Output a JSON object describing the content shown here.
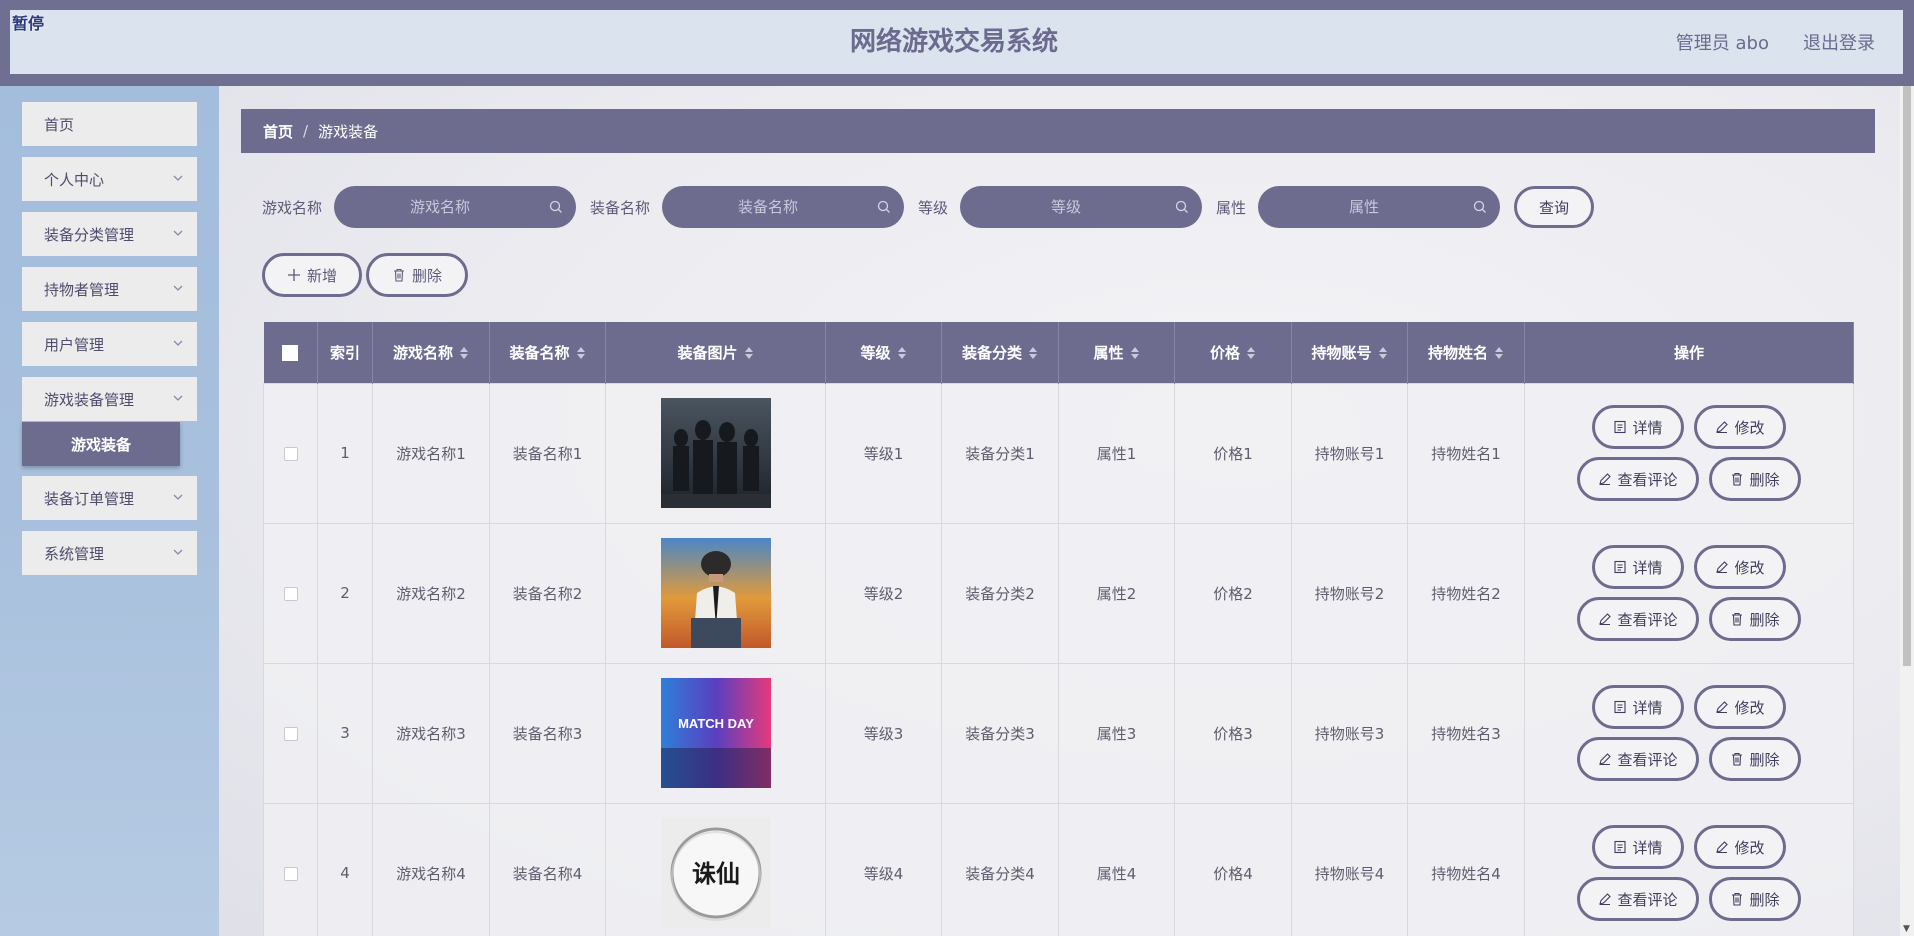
{
  "header": {
    "pause_tag": "暂停",
    "title": "网络游戏交易系统",
    "user": "管理员 abo",
    "logout": "退出登录"
  },
  "sidebar": {
    "items": [
      {
        "label": "首页",
        "icon": "none"
      },
      {
        "label": "个人中心",
        "icon": "chevron-down-icon"
      },
      {
        "label": "装备分类管理",
        "icon": "chevron-down-icon"
      },
      {
        "label": "持物者管理",
        "icon": "chevron-down-icon"
      },
      {
        "label": "用户管理",
        "icon": "chevron-down-icon"
      },
      {
        "label": "游戏装备管理",
        "icon": "chevron-down-icon"
      },
      {
        "label": "装备订单管理",
        "icon": "chevron-down-icon"
      },
      {
        "label": "系统管理",
        "icon": "chevron-down-icon"
      }
    ],
    "active_sub": "游戏装备"
  },
  "breadcrumb": {
    "home": "首页",
    "separator": "/",
    "current": "游戏装备"
  },
  "search": {
    "fields": [
      {
        "label": "游戏名称",
        "placeholder": "游戏名称"
      },
      {
        "label": "装备名称",
        "placeholder": "装备名称"
      },
      {
        "label": "等级",
        "placeholder": "等级"
      },
      {
        "label": "属性",
        "placeholder": "属性"
      }
    ],
    "query_label": "查询"
  },
  "actions": {
    "add_label": "新增",
    "delete_label": "删除"
  },
  "table": {
    "headers": [
      "索引",
      "游戏名称",
      "装备名称",
      "装备图片",
      "等级",
      "装备分类",
      "属性",
      "价格",
      "持物账号",
      "持物姓名",
      "操作"
    ],
    "rows": [
      {
        "index": "1",
        "game": "游戏名称1",
        "equip": "装备名称1",
        "level": "等级1",
        "category": "装备分类1",
        "attr": "属性1",
        "price": "价格1",
        "account": "持物账号1",
        "owner": "持物姓名1"
      },
      {
        "index": "2",
        "game": "游戏名称2",
        "equip": "装备名称2",
        "level": "等级2",
        "category": "装备分类2",
        "attr": "属性2",
        "price": "价格2",
        "account": "持物账号2",
        "owner": "持物姓名2"
      },
      {
        "index": "3",
        "game": "游戏名称3",
        "equip": "装备名称3",
        "level": "等级3",
        "category": "装备分类3",
        "attr": "属性3",
        "price": "价格3",
        "account": "持物账号3",
        "owner": "持物姓名3"
      },
      {
        "index": "4",
        "game": "游戏名称4",
        "equip": "装备名称4",
        "level": "等级4",
        "category": "装备分类4",
        "attr": "属性4",
        "price": "价格4",
        "account": "持物账号4",
        "owner": "持物姓名4"
      }
    ],
    "ops": {
      "detail": "详情",
      "edit": "修改",
      "comments": "查看评论",
      "delete": "删除"
    },
    "image_art": [
      {
        "text": ""
      },
      {
        "text": ""
      },
      {
        "text": "MATCH DAY"
      },
      {
        "text": "诛仙"
      }
    ]
  },
  "colors": {
    "accent": "#6d6b8e",
    "header_bg": "#dae3ee",
    "sidebar_bg": "#a8c0dd"
  }
}
